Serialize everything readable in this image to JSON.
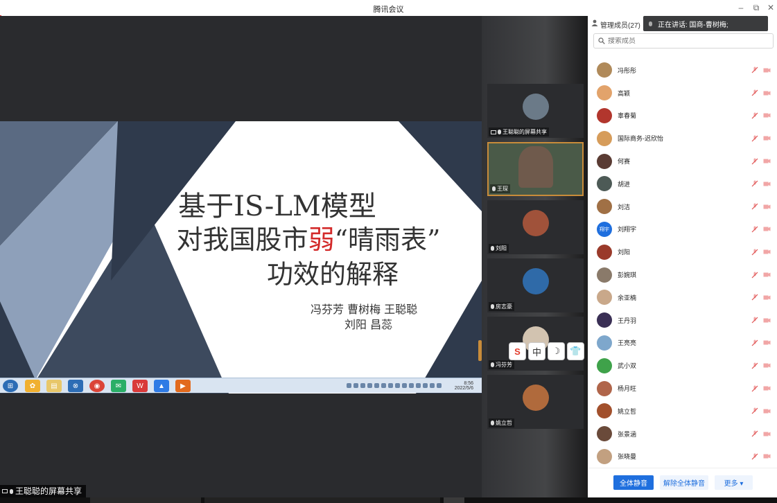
{
  "window": {
    "title": "腾讯会议",
    "minimize": "–",
    "restore": "⧉",
    "close": "✕"
  },
  "slide": {
    "line1": "基于IS-LM模型",
    "line2_a": "对我国股市",
    "line2_red": "弱",
    "line2_b": "“晴雨表”",
    "line3": "功效的解释",
    "authors1": "冯芬芳  曹树梅  王聪聪",
    "authors2": "刘阳  昌蕊"
  },
  "taskbar": {
    "time": "8:56",
    "date": "2022/5/6"
  },
  "share_label": "王聪聪的屏幕共享",
  "videos": [
    {
      "name": "王聪聪的屏幕共享",
      "color": "#6b7a88"
    },
    {
      "name": "王琛",
      "color": "#6f5a4c"
    },
    {
      "name": "刘阳",
      "color": "#a0523a"
    },
    {
      "name": "房志豪",
      "color": "#2f6aa8"
    },
    {
      "name": "冯芬芳",
      "color": "#d2c3b0"
    },
    {
      "name": "姚立哲",
      "color": "#b06a3c"
    }
  ],
  "ime": [
    "S",
    "中",
    "☽",
    "👕"
  ],
  "panel": {
    "title": "管理成员(27)",
    "speaking": "正在讲话: 国商-曹树梅;",
    "search_placeholder": "搜索成员",
    "members": [
      {
        "name": "冯彤彤",
        "color": "#b08a5a"
      },
      {
        "name": "高颖",
        "color": "#e2a36b"
      },
      {
        "name": "辜春菊",
        "color": "#b2362d"
      },
      {
        "name": "国际商务-迟欣怡",
        "color": "#d69c5a"
      },
      {
        "name": "何赛",
        "color": "#5a3b33"
      },
      {
        "name": "胡进",
        "color": "#4d5a56"
      },
      {
        "name": "刘洁",
        "color": "#a07045"
      },
      {
        "name": "刘翔宇",
        "color": "#1f6fde",
        "initials": "翔宇"
      },
      {
        "name": "刘阳",
        "color": "#9a3a2a"
      },
      {
        "name": "彭婉琪",
        "color": "#8a7a6a"
      },
      {
        "name": "余亚楠",
        "color": "#c9a88a"
      },
      {
        "name": "王丹羽",
        "color": "#3a2f55"
      },
      {
        "name": "王亮亮",
        "color": "#7ea7cc"
      },
      {
        "name": "武小双",
        "color": "#3fa24a"
      },
      {
        "name": "杨月旺",
        "color": "#b0654a"
      },
      {
        "name": "姚立哲",
        "color": "#a2502c"
      },
      {
        "name": "张景涵",
        "color": "#6a4a3a"
      },
      {
        "name": "张晓曼",
        "color": "#c2a080"
      }
    ],
    "btn_mute_all": "全体静音",
    "btn_unmute_all": "解除全体静音",
    "btn_more": "更多 ▾"
  }
}
